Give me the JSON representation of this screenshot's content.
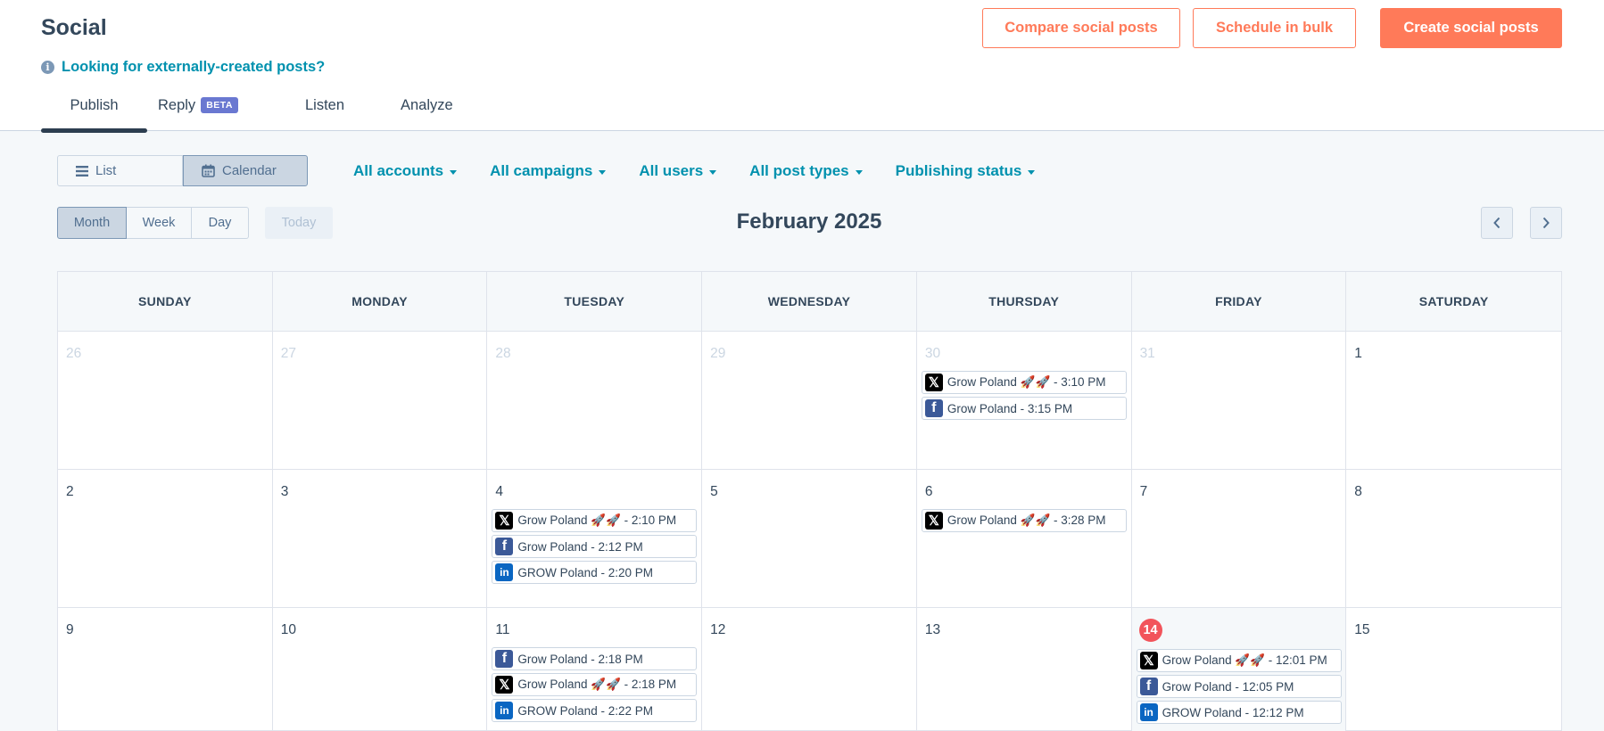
{
  "header": {
    "title": "Social",
    "external_link": "Looking for externally-created posts?",
    "buttons": {
      "compare": "Compare social posts",
      "bulk": "Schedule in bulk",
      "create": "Create social posts"
    }
  },
  "tabs": [
    {
      "label": "Publish",
      "active": true
    },
    {
      "label": "Reply",
      "badge": "BETA"
    },
    {
      "label": "Listen"
    },
    {
      "label": "Analyze"
    }
  ],
  "view_toggle": {
    "list": "List",
    "calendar": "Calendar",
    "selected": "calendar"
  },
  "filters": [
    "All accounts",
    "All campaigns",
    "All users",
    "All post types",
    "Publishing status"
  ],
  "range_toggle": {
    "month": "Month",
    "week": "Week",
    "day": "Day",
    "selected": "month"
  },
  "today_label": "Today",
  "calendar": {
    "month_title": "February 2025",
    "weekdays": [
      "SUNDAY",
      "MONDAY",
      "TUESDAY",
      "WEDNESDAY",
      "THURSDAY",
      "FRIDAY",
      "SATURDAY"
    ],
    "days": [
      {
        "day": "26",
        "muted": true,
        "events": []
      },
      {
        "day": "27",
        "muted": true,
        "events": []
      },
      {
        "day": "28",
        "muted": true,
        "events": []
      },
      {
        "day": "29",
        "muted": true,
        "events": []
      },
      {
        "day": "30",
        "muted": true,
        "events": [
          {
            "network": "x",
            "text": "Grow Poland 🚀🚀 - 3:10 PM"
          },
          {
            "network": "facebook",
            "text": "Grow Poland - 3:15 PM"
          }
        ]
      },
      {
        "day": "31",
        "muted": true,
        "events": []
      },
      {
        "day": "1",
        "events": []
      },
      {
        "day": "2",
        "events": []
      },
      {
        "day": "3",
        "events": []
      },
      {
        "day": "4",
        "events": [
          {
            "network": "x",
            "text": "Grow Poland 🚀🚀 - 2:10 PM"
          },
          {
            "network": "facebook",
            "text": "Grow Poland - 2:12 PM"
          },
          {
            "network": "linkedin",
            "text": "GROW Poland - 2:20 PM"
          }
        ]
      },
      {
        "day": "5",
        "events": []
      },
      {
        "day": "6",
        "events": [
          {
            "network": "x",
            "text": "Grow Poland 🚀🚀 - 3:28 PM"
          }
        ]
      },
      {
        "day": "7",
        "events": []
      },
      {
        "day": "8",
        "events": []
      },
      {
        "day": "9",
        "events": []
      },
      {
        "day": "10",
        "events": []
      },
      {
        "day": "11",
        "events": [
          {
            "network": "facebook",
            "text": "Grow Poland - 2:18 PM"
          },
          {
            "network": "x",
            "text": "Grow Poland 🚀🚀 - 2:18 PM"
          },
          {
            "network": "linkedin",
            "text": "GROW Poland - 2:22 PM"
          }
        ]
      },
      {
        "day": "12",
        "events": []
      },
      {
        "day": "13",
        "events": []
      },
      {
        "day": "14",
        "today": true,
        "events": [
          {
            "network": "x",
            "text": "Grow Poland 🚀🚀 - 12:01 PM"
          },
          {
            "network": "facebook",
            "text": "Grow Poland - 12:05 PM"
          },
          {
            "network": "linkedin",
            "text": "GROW Poland - 12:12 PM"
          }
        ]
      },
      {
        "day": "15",
        "events": []
      }
    ]
  },
  "colors": {
    "accent": "#ff7a59",
    "link": "#0091ae",
    "today": "#f2545b",
    "text": "#33475b"
  }
}
